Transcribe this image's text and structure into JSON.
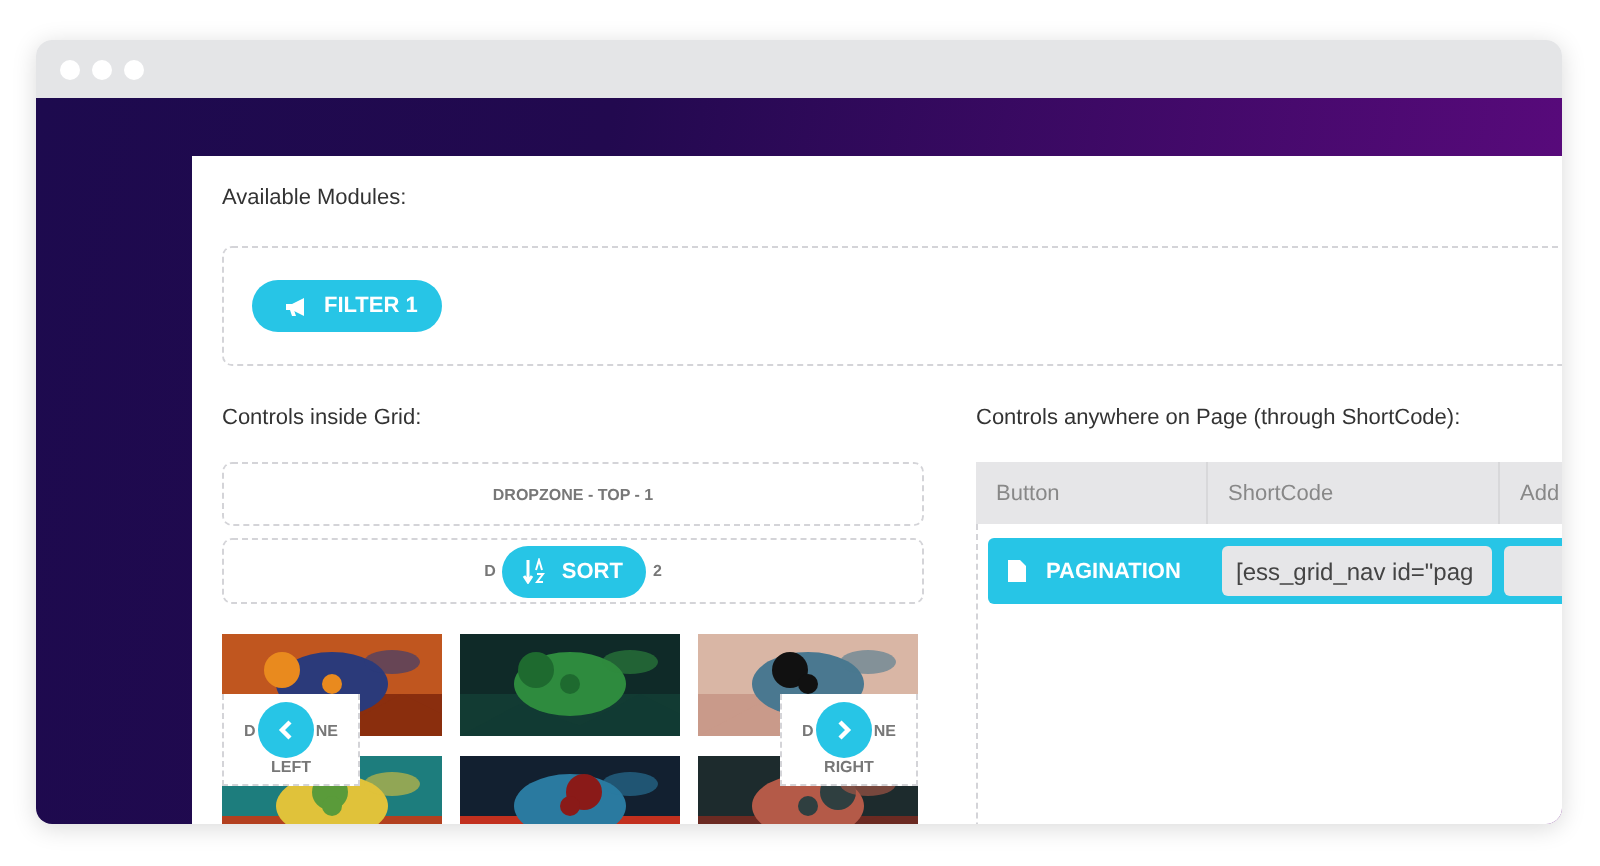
{
  "available_modules": {
    "label": "Available Modules:",
    "modules": [
      {
        "label": "FILTER 1"
      }
    ]
  },
  "grid_controls": {
    "label": "Controls inside Grid:",
    "dropzone_top_1": "DROPZONE - TOP - 1",
    "dropzone_top_2": {
      "before": "D",
      "after": "2"
    },
    "sort_button": "SORT",
    "dropzone_left": {
      "before": "D",
      "after": "NE",
      "line_2": "LEFT"
    },
    "dropzone_right": {
      "before": "D",
      "after": "NE",
      "line_2": "RIGHT"
    }
  },
  "page_controls": {
    "label": "Controls anywhere on Page (through ShortCode):",
    "columns": [
      "Button",
      "ShortCode",
      "Add"
    ],
    "rows": [
      {
        "button": "PAGINATION",
        "shortcode": "[ess_grid_nav id=\"pag"
      }
    ]
  }
}
